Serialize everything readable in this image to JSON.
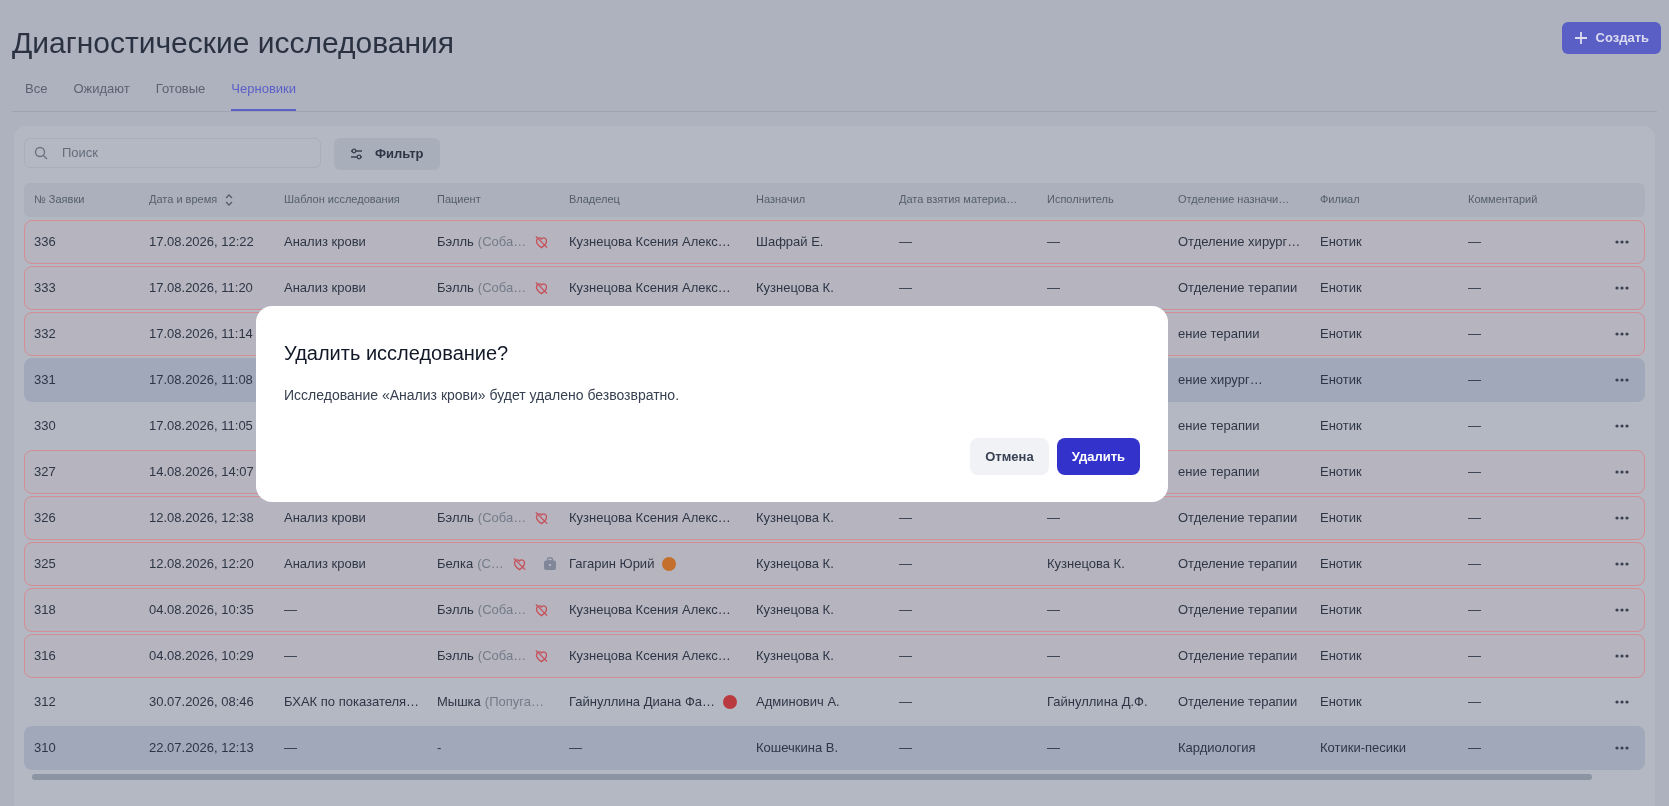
{
  "title": "Диагностические исследования",
  "create_button": "Создать",
  "tabs": [
    {
      "label": "Все",
      "selected": false
    },
    {
      "label": "Ожидают",
      "selected": false
    },
    {
      "label": "Готовые",
      "selected": false
    },
    {
      "label": "Черновики",
      "selected": true
    }
  ],
  "search": {
    "placeholder": "Поиск"
  },
  "filter_button": "Фильтр",
  "table": {
    "columns": [
      {
        "label": "№ Заявки"
      },
      {
        "label": "Дата и время",
        "sortable": true
      },
      {
        "label": "Шаблон исследования"
      },
      {
        "label": "Пациент"
      },
      {
        "label": "Владелец"
      },
      {
        "label": "Назначил"
      },
      {
        "label": "Дата взятия материа…"
      },
      {
        "label": "Исполнитель"
      },
      {
        "label": "Отделение назначи…"
      },
      {
        "label": "Филиал"
      },
      {
        "label": "Комментарий"
      }
    ],
    "rows": [
      {
        "number": "336",
        "datetime": "17.08.2026, 12:22",
        "template": "Анализ крови",
        "patient": {
          "name": "Бэлль",
          "species": "(Соба…",
          "icons": [
            {
              "kind": "crossed-heart"
            }
          ]
        },
        "owner": {
          "name": "Кузнецова Ксения Алекс…"
        },
        "assigned": "Шафрай Е.",
        "sample_date": "—",
        "executor": "—",
        "department": "Отделение хирург…",
        "branch": "Енотик",
        "comment": "—",
        "flagged": true,
        "highlighted": false
      },
      {
        "number": "333",
        "datetime": "17.08.2026, 11:20",
        "template": "Анализ крови",
        "patient": {
          "name": "Бэлль",
          "species": "(Соба…",
          "icons": [
            {
              "kind": "crossed-heart"
            }
          ]
        },
        "owner": {
          "name": "Кузнецова Ксения Алекс…"
        },
        "assigned": "Кузнецова К.",
        "sample_date": "—",
        "executor": "—",
        "department": "Отделение терапии",
        "branch": "Енотик",
        "comment": "—",
        "flagged": true,
        "highlighted": false
      },
      {
        "number": "332",
        "datetime": "17.08.2026, 11:14",
        "department": "ение терапии",
        "branch": "Енотик",
        "comment": "—",
        "flagged": true,
        "highlighted": false
      },
      {
        "number": "331",
        "datetime": "17.08.2026, 11:08",
        "department": "ение хирург…",
        "branch": "Енотик",
        "comment": "—",
        "flagged": false,
        "highlighted": true
      },
      {
        "number": "330",
        "datetime": "17.08.2026, 11:05",
        "department": "ение терапии",
        "branch": "Енотик",
        "comment": "—",
        "flagged": false,
        "highlighted": false
      },
      {
        "number": "327",
        "datetime": "14.08.2026, 14:07",
        "department": "ение терапии",
        "branch": "Енотик",
        "comment": "—",
        "flagged": true,
        "highlighted": false
      },
      {
        "number": "326",
        "datetime": "12.08.2026, 12:38",
        "template": "Анализ крови",
        "patient": {
          "name": "Бэлль",
          "species": "(Соба…",
          "icons": [
            {
              "kind": "crossed-heart"
            }
          ]
        },
        "owner": {
          "name": "Кузнецова Ксения Алекс…"
        },
        "assigned": "Кузнецова К.",
        "sample_date": "—",
        "executor": "—",
        "department": "Отделение терапии",
        "branch": "Енотик",
        "comment": "—",
        "flagged": true,
        "highlighted": false
      },
      {
        "number": "325",
        "datetime": "12.08.2026, 12:20",
        "template": "Анализ крови",
        "patient": {
          "name": "Белка",
          "species": "(С…",
          "icons": [
            {
              "kind": "crossed-heart"
            },
            {
              "kind": "briefcase"
            }
          ]
        },
        "owner": {
          "name": "Гагарин Юрий",
          "color": "#c4702c"
        },
        "assigned": "Кузнецова К.",
        "sample_date": "—",
        "executor": "Кузнецова К.",
        "department": "Отделение терапии",
        "branch": "Енотик",
        "comment": "—",
        "flagged": true,
        "highlighted": false
      },
      {
        "number": "318",
        "datetime": "04.08.2026, 10:35",
        "template": "—",
        "patient": {
          "name": "Бэлль",
          "species": "(Соба…",
          "icons": [
            {
              "kind": "crossed-heart"
            }
          ]
        },
        "owner": {
          "name": "Кузнецова Ксения Алекс…"
        },
        "assigned": "Кузнецова К.",
        "sample_date": "—",
        "executor": "—",
        "department": "Отделение терапии",
        "branch": "Енотик",
        "comment": "—",
        "flagged": true,
        "highlighted": false
      },
      {
        "number": "316",
        "datetime": "04.08.2026, 10:29",
        "template": "—",
        "patient": {
          "name": "Бэлль",
          "species": "(Соба…",
          "icons": [
            {
              "kind": "crossed-heart"
            }
          ]
        },
        "owner": {
          "name": "Кузнецова Ксения Алекс…"
        },
        "assigned": "Кузнецова К.",
        "sample_date": "—",
        "executor": "—",
        "department": "Отделение терапии",
        "branch": "Енотик",
        "comment": "—",
        "flagged": true,
        "highlighted": false
      },
      {
        "number": "312",
        "datetime": "30.07.2026, 08:46",
        "template": "БХАК по показателя…",
        "patient": {
          "name": "Мышка",
          "species": "(Попуга…"
        },
        "owner": {
          "name": "Гайнуллина Диана Фа…",
          "color": "#b83a3e"
        },
        "assigned": "Админович А.",
        "sample_date": "—",
        "executor": "Гайнуллина Д.Ф.",
        "department": "Отделение терапии",
        "branch": "Енотик",
        "comment": "—",
        "flagged": false,
        "highlighted": false
      },
      {
        "number": "310",
        "datetime": "22.07.2026, 12:13",
        "template": "—",
        "patient": {
          "name": "-"
        },
        "owner": {
          "name": "—"
        },
        "assigned": "Кошечкина В.",
        "sample_date": "—",
        "executor": "—",
        "department": "Кардиология",
        "branch": "Котики-песики",
        "comment": "—",
        "flagged": false,
        "highlighted": true
      }
    ]
  },
  "dialog": {
    "title": "Удалить исследование?",
    "message": "Исследование «Анализ крови» будет удалено безвозвратно.",
    "buttons": [
      {
        "label": "Отмена",
        "kind": "secondary"
      },
      {
        "label": "Удалить",
        "kind": "primary"
      }
    ]
  }
}
